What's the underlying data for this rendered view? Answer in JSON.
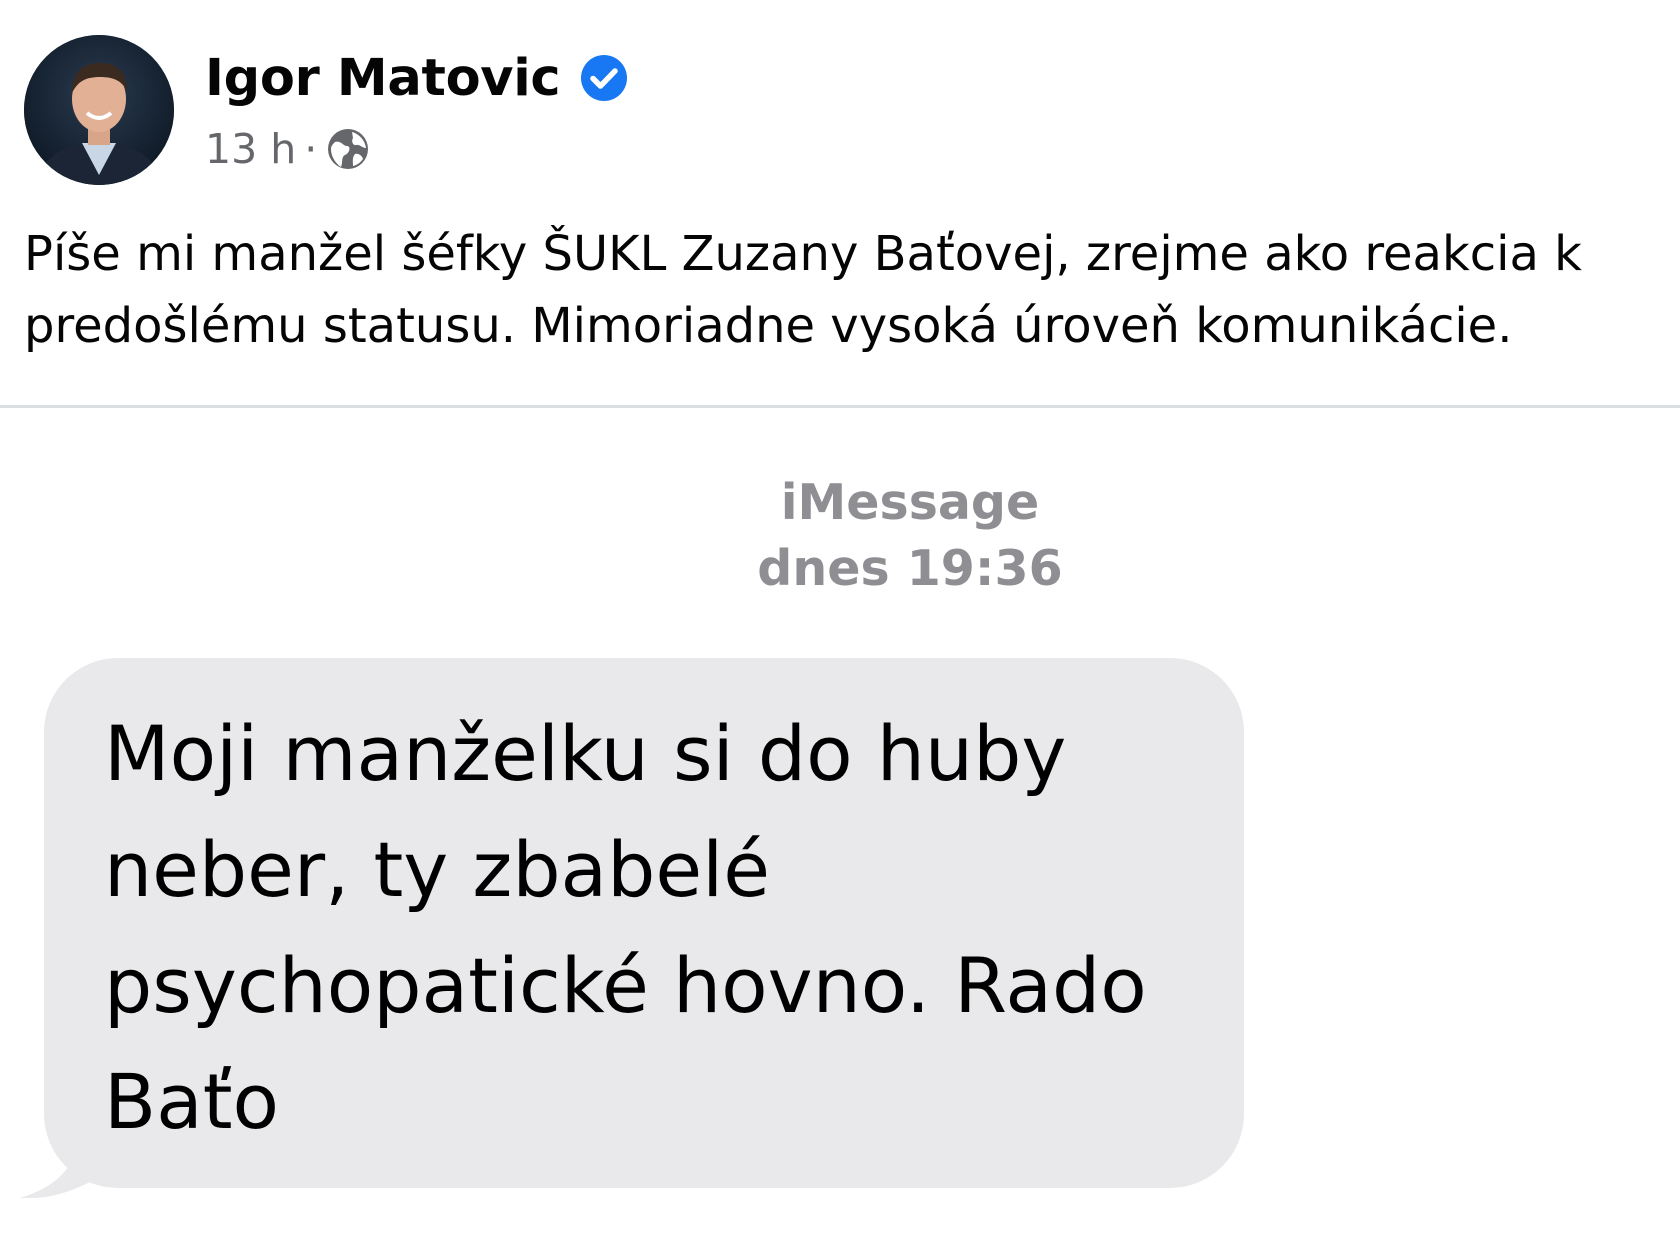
{
  "post": {
    "author": {
      "name": "Igor Matovic",
      "verified": true,
      "avatar_icon": "profile-photo"
    },
    "time": "13 h",
    "separator": "·",
    "audience_icon": "globe-icon",
    "text": "Píše mi manžel šéfky ŠUKL Zuzany Baťovej, zrejme ako reakcia k\npredošlému statusu. Mimoriadne vysoká úroveň komunikácie."
  },
  "screenshot": {
    "service_label": "iMessage",
    "timestamp": "dnes 19:36",
    "message": {
      "text": "Moji manželku si do huby\nneber, ty zbabelé\npsychopatické hovno. Rado\nBaťo",
      "direction": "incoming"
    }
  },
  "colors": {
    "verified_badge": "#1877f2",
    "secondary_text": "#65676b",
    "imessage_gray_text": "#8e8e93",
    "bubble_incoming": "#e9e9eb",
    "divider": "#dadde1"
  }
}
